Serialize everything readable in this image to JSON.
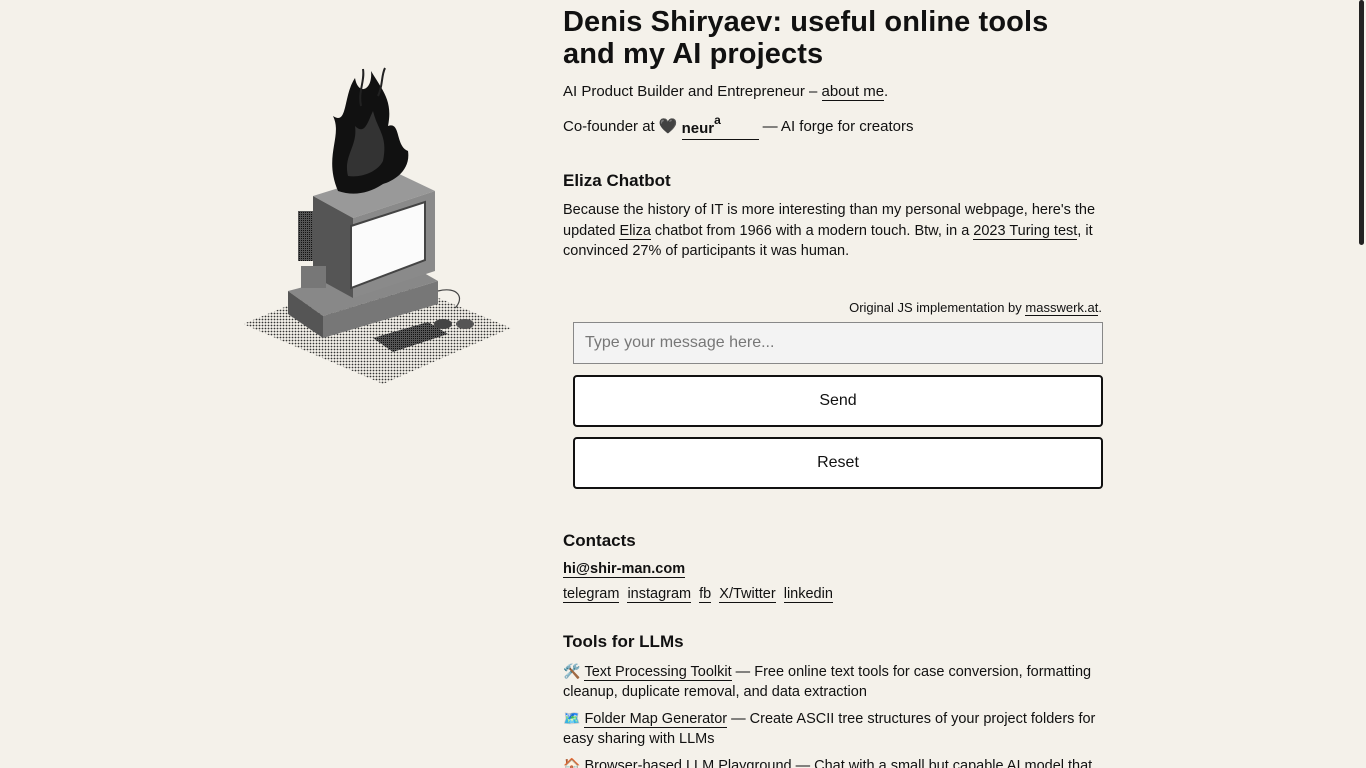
{
  "header": {
    "title": "Denis Shiryaev: useful online tools and my AI projects",
    "subtitle_prefix": "AI Product Builder and Entrepreneur – ",
    "about_link": "about me",
    "subtitle_suffix": ".",
    "cofounder_prefix": "Co-founder at",
    "heart": "🖤",
    "neura_text": "neur",
    "neura_sup": "a",
    "cofounder_suffix": "— AI forge for creators"
  },
  "eliza": {
    "heading": "Eliza Chatbot",
    "text_1": "Because the history of IT is more interesting than my personal webpage, here's the updated ",
    "eliza_link": "Eliza",
    "text_2": " chatbot from 1966 with a modern touch. Btw, in a ",
    "turing_link": "2023 Turing test",
    "text_3": ", it convinced 27% of participants it was human.",
    "orig_prefix": "Original JS implementation by ",
    "orig_link": "masswerk.at",
    "orig_suffix": ".",
    "input_placeholder": "Type your message here...",
    "send_label": "Send",
    "reset_label": "Reset"
  },
  "contacts": {
    "heading": "Contacts",
    "email": "hi@shir-man.com",
    "links": [
      "telegram",
      "instagram",
      "fb",
      "X/Twitter",
      "linkedin"
    ]
  },
  "tools": {
    "heading": "Tools for LLMs",
    "items": [
      {
        "emoji": "🛠️",
        "link": "Text Processing Toolkit",
        "desc": " — Free online text tools for case conversion, formatting cleanup, duplicate removal, and data extraction"
      },
      {
        "emoji": "🗺️",
        "link": "Folder Map Generator",
        "desc": " — Create ASCII tree structures of your project folders for easy sharing with LLMs"
      },
      {
        "emoji": "🏠",
        "link": "Browser-based LLM Playground",
        "desc": " — Chat with a small but capable AI model that"
      }
    ]
  },
  "colors": {
    "background": "#f4f1ea",
    "text": "#111111",
    "button_bg": "#ffffff"
  }
}
